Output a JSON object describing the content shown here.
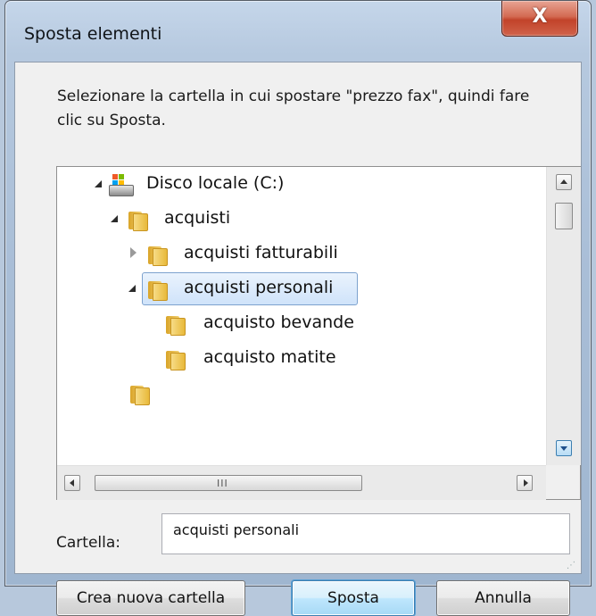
{
  "window": {
    "title": "Sposta elementi",
    "close_glyph": "X"
  },
  "instruction": "Selezionare la cartella in cui spostare \"prezzo fax\", quindi fare clic su Sposta.",
  "tree": {
    "items": [
      {
        "label": "Disco locale (C:)",
        "icon": "drive-icon",
        "level": 0,
        "expander": "expanded",
        "selected": false
      },
      {
        "label": "acquisti",
        "icon": "folder-icon",
        "level": 1,
        "expander": "expanded",
        "selected": false
      },
      {
        "label": "acquisti fatturabili",
        "icon": "folder-icon",
        "level": 2,
        "expander": "collapsed",
        "selected": false
      },
      {
        "label": "acquisti personali",
        "icon": "folder-icon",
        "level": 2,
        "expander": "expanded",
        "selected": true
      },
      {
        "label": "acquisto bevande",
        "icon": "folder-icon",
        "level": 3,
        "expander": "none",
        "selected": false
      },
      {
        "label": "acquisto matite",
        "icon": "folder-icon",
        "level": 3,
        "expander": "none",
        "selected": false
      }
    ],
    "hscroll_grip": "III"
  },
  "folder_field": {
    "label": "Cartella:",
    "value": "acquisti personali"
  },
  "buttons": {
    "new_folder": "Crea nuova cartella",
    "move": "Sposta",
    "cancel": "Annulla"
  },
  "colors": {
    "selection": "#cfe3fa",
    "close_button": "#c2432a",
    "default_button": "#bee6fd"
  }
}
